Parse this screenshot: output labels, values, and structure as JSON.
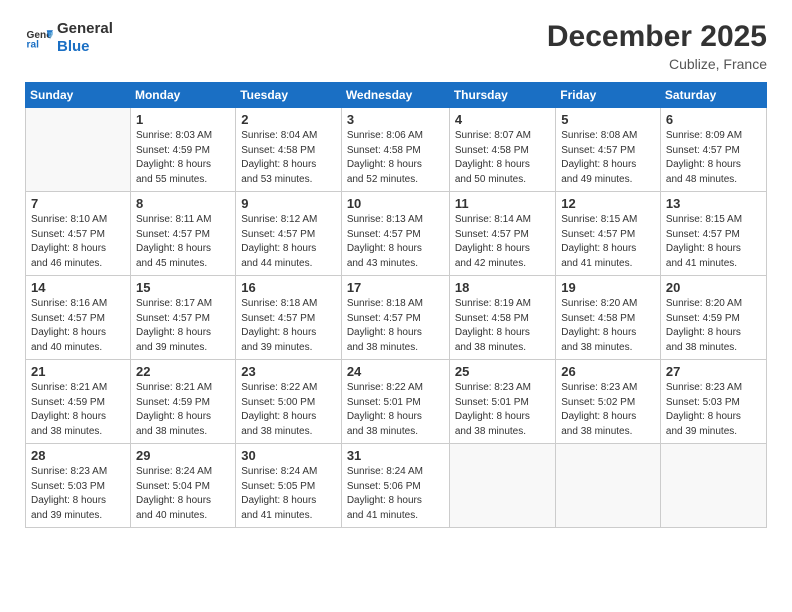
{
  "logo": {
    "line1": "General",
    "line2": "Blue"
  },
  "title": "December 2025",
  "subtitle": "Cublize, France",
  "days_of_week": [
    "Sunday",
    "Monday",
    "Tuesday",
    "Wednesday",
    "Thursday",
    "Friday",
    "Saturday"
  ],
  "weeks": [
    [
      {
        "day": "",
        "info": ""
      },
      {
        "day": "1",
        "info": "Sunrise: 8:03 AM\nSunset: 4:59 PM\nDaylight: 8 hours\nand 55 minutes."
      },
      {
        "day": "2",
        "info": "Sunrise: 8:04 AM\nSunset: 4:58 PM\nDaylight: 8 hours\nand 53 minutes."
      },
      {
        "day": "3",
        "info": "Sunrise: 8:06 AM\nSunset: 4:58 PM\nDaylight: 8 hours\nand 52 minutes."
      },
      {
        "day": "4",
        "info": "Sunrise: 8:07 AM\nSunset: 4:58 PM\nDaylight: 8 hours\nand 50 minutes."
      },
      {
        "day": "5",
        "info": "Sunrise: 8:08 AM\nSunset: 4:57 PM\nDaylight: 8 hours\nand 49 minutes."
      },
      {
        "day": "6",
        "info": "Sunrise: 8:09 AM\nSunset: 4:57 PM\nDaylight: 8 hours\nand 48 minutes."
      }
    ],
    [
      {
        "day": "7",
        "info": "Sunrise: 8:10 AM\nSunset: 4:57 PM\nDaylight: 8 hours\nand 46 minutes."
      },
      {
        "day": "8",
        "info": "Sunrise: 8:11 AM\nSunset: 4:57 PM\nDaylight: 8 hours\nand 45 minutes."
      },
      {
        "day": "9",
        "info": "Sunrise: 8:12 AM\nSunset: 4:57 PM\nDaylight: 8 hours\nand 44 minutes."
      },
      {
        "day": "10",
        "info": "Sunrise: 8:13 AM\nSunset: 4:57 PM\nDaylight: 8 hours\nand 43 minutes."
      },
      {
        "day": "11",
        "info": "Sunrise: 8:14 AM\nSunset: 4:57 PM\nDaylight: 8 hours\nand 42 minutes."
      },
      {
        "day": "12",
        "info": "Sunrise: 8:15 AM\nSunset: 4:57 PM\nDaylight: 8 hours\nand 41 minutes."
      },
      {
        "day": "13",
        "info": "Sunrise: 8:15 AM\nSunset: 4:57 PM\nDaylight: 8 hours\nand 41 minutes."
      }
    ],
    [
      {
        "day": "14",
        "info": "Sunrise: 8:16 AM\nSunset: 4:57 PM\nDaylight: 8 hours\nand 40 minutes."
      },
      {
        "day": "15",
        "info": "Sunrise: 8:17 AM\nSunset: 4:57 PM\nDaylight: 8 hours\nand 39 minutes."
      },
      {
        "day": "16",
        "info": "Sunrise: 8:18 AM\nSunset: 4:57 PM\nDaylight: 8 hours\nand 39 minutes."
      },
      {
        "day": "17",
        "info": "Sunrise: 8:18 AM\nSunset: 4:57 PM\nDaylight: 8 hours\nand 38 minutes."
      },
      {
        "day": "18",
        "info": "Sunrise: 8:19 AM\nSunset: 4:58 PM\nDaylight: 8 hours\nand 38 minutes."
      },
      {
        "day": "19",
        "info": "Sunrise: 8:20 AM\nSunset: 4:58 PM\nDaylight: 8 hours\nand 38 minutes."
      },
      {
        "day": "20",
        "info": "Sunrise: 8:20 AM\nSunset: 4:59 PM\nDaylight: 8 hours\nand 38 minutes."
      }
    ],
    [
      {
        "day": "21",
        "info": "Sunrise: 8:21 AM\nSunset: 4:59 PM\nDaylight: 8 hours\nand 38 minutes."
      },
      {
        "day": "22",
        "info": "Sunrise: 8:21 AM\nSunset: 4:59 PM\nDaylight: 8 hours\nand 38 minutes."
      },
      {
        "day": "23",
        "info": "Sunrise: 8:22 AM\nSunset: 5:00 PM\nDaylight: 8 hours\nand 38 minutes."
      },
      {
        "day": "24",
        "info": "Sunrise: 8:22 AM\nSunset: 5:01 PM\nDaylight: 8 hours\nand 38 minutes."
      },
      {
        "day": "25",
        "info": "Sunrise: 8:23 AM\nSunset: 5:01 PM\nDaylight: 8 hours\nand 38 minutes."
      },
      {
        "day": "26",
        "info": "Sunrise: 8:23 AM\nSunset: 5:02 PM\nDaylight: 8 hours\nand 38 minutes."
      },
      {
        "day": "27",
        "info": "Sunrise: 8:23 AM\nSunset: 5:03 PM\nDaylight: 8 hours\nand 39 minutes."
      }
    ],
    [
      {
        "day": "28",
        "info": "Sunrise: 8:23 AM\nSunset: 5:03 PM\nDaylight: 8 hours\nand 39 minutes."
      },
      {
        "day": "29",
        "info": "Sunrise: 8:24 AM\nSunset: 5:04 PM\nDaylight: 8 hours\nand 40 minutes."
      },
      {
        "day": "30",
        "info": "Sunrise: 8:24 AM\nSunset: 5:05 PM\nDaylight: 8 hours\nand 41 minutes."
      },
      {
        "day": "31",
        "info": "Sunrise: 8:24 AM\nSunset: 5:06 PM\nDaylight: 8 hours\nand 41 minutes."
      },
      {
        "day": "",
        "info": ""
      },
      {
        "day": "",
        "info": ""
      },
      {
        "day": "",
        "info": ""
      }
    ]
  ]
}
